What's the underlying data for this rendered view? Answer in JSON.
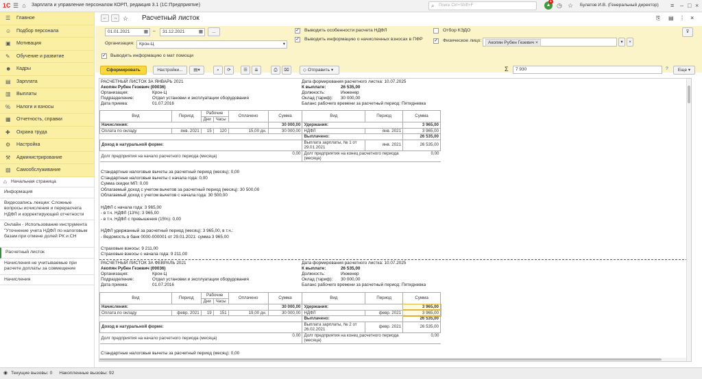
{
  "app": {
    "logo": "1С",
    "title": "Зарплата и управление персоналом КОРП, редакция 3.1  (1С:Предприятие)",
    "search_placeholder": "Поиск Ctrl+Shift+F",
    "notif_count": "1",
    "user": "Булатов И.В. (Генеральный директор)"
  },
  "sidebar": {
    "nav": [
      {
        "icon": "☰",
        "label": "Главное"
      },
      {
        "icon": "☺",
        "label": "Подбор персонала"
      },
      {
        "icon": "▣",
        "label": "Мотивация"
      },
      {
        "icon": "✎",
        "label": "Обучение и развитие"
      },
      {
        "icon": "☻",
        "label": "Кадры"
      },
      {
        "icon": "▤",
        "label": "Зарплата"
      },
      {
        "icon": "▥",
        "label": "Выплаты"
      },
      {
        "icon": "%",
        "label": "Налоги и взносы"
      },
      {
        "icon": "▦",
        "label": "Отчетность, справки"
      },
      {
        "icon": "✚",
        "label": "Охрана труда"
      },
      {
        "icon": "⚙",
        "label": "Настройка"
      },
      {
        "icon": "⚒",
        "label": "Администрирование"
      },
      {
        "icon": "▧",
        "label": "Самообслуживание"
      }
    ],
    "home": "Начальная страница",
    "links": [
      "Информация",
      "Видеозапись лекции: Сложные вопросы исчисления и перерасчета НДФЛ и корректирующей отчетности",
      "Онлайн - Использование инструмента \"Уточнение учета НДФЛ по налоговым базам при отмене долей РК и СН",
      "Расчетный листок",
      "Начисления не учитываемые при расчете доплаты за совмещение",
      "Начисления"
    ]
  },
  "header": {
    "title": "Расчетный листок"
  },
  "filters": {
    "date_from": "01.01.2021",
    "date_to": "31.12.2021",
    "dash": "–",
    "more": "...",
    "org_label": "Организация:",
    "org_value": "Крон-Ц",
    "chk_ndfl": "Выводить особенности расчета НДФЛ",
    "chk_pfr": "Выводить информацию о начисленных взносах в ПФР",
    "chk_kedo": "Отбор КЭДО",
    "chk_person": "Физическое лицо:",
    "person_value": "Акопян Рубен Гезевич",
    "chk_mat": "Выводить информацию о мат помощи"
  },
  "toolbar": {
    "generate": "Сформировать",
    "settings": "Настройки...",
    "send": "Отправить",
    "sigma": "Σ",
    "sum": "7 930",
    "help": "?",
    "more": "Еще"
  },
  "report": {
    "jan": {
      "title": "РАСЧЕТНЫЙ ЛИСТОК ЗА ЯНВАРЬ 2021",
      "name": "Акопян Рубен Гезевич (00036)",
      "org_l": "Организация:",
      "org": "Крон-Ц",
      "dep_l": "Подразделение:",
      "dep": "Отдел установки и эксплуатации оборудования",
      "hire_l": "Дата приема:",
      "hire": "01.07.2016",
      "formed": "Дата формирования расчетного листка: 10.07.2025",
      "topay_l": "К выплате:",
      "topay": "26 535,00",
      "pos_l": "Должность:",
      "pos": "Инженер",
      "rate_l": "Оклад (тариф):",
      "rate": "30 000,00",
      "balance": "Баланс рабочего времени за расчетный период: Пятидневка",
      "h": {
        "vid": "Вид",
        "period": "Период",
        "work": "Рабочие",
        "days": "Дни",
        "hours": "Часы",
        "paid": "Оплачено",
        "sum": "Сумма"
      },
      "accr_l": "Начисления:",
      "accr_sum": "30 000,00",
      "ded_l": "Удержания:",
      "ded_sum": "3 965,00",
      "row": {
        "vid": "Оплата по окладу",
        "period": "янв. 2021",
        "days": "15",
        "hours": "120",
        "paid": "15,00 дн.",
        "sum": "30 000,00"
      },
      "ndfl": "НДФЛ",
      "ndfl_period": "янв. 2021",
      "ndfl_sum": "3 965,00",
      "paid_l": "Выплачено:",
      "paid_sum": "26 535,00",
      "natural": "Доход в натуральной форме:",
      "payout": "Выплата зарплаты, № 1 от 29.01.2021",
      "payout_period": "янв. 2021",
      "payout_sum": "26 535,00",
      "debt_start": "Долг предприятия на начало расчетного периода (месяца)",
      "debt_start_v": "0,00",
      "debt_end": "Долг предприятия на конец расчетного периода (месяца)",
      "debt_end_v": "0,00",
      "notes": [
        "Стандартные налоговые вычеты за расчетный период (месяц): 0,00",
        "Стандартные налоговые вычеты с начала года: 0,00",
        "Сумма скидки МП: 0,00",
        "Облагаемый доход с учетом вычетов за расчетный период (месяц): 30 500,00",
        "Облагаемый доход с учетом вычетов с начала года: 30 500,00",
        "",
        "НДФЛ с начала года: 3 965,00",
        " - в т.ч. НДФЛ (13%): 3 965,00",
        " - в т.ч. НДФЛ с превышения (15%): 0,00",
        "",
        "НДФЛ удержанный за расчетный период (месяц): 3 965,00, в т.ч.:",
        " - Ведомость в банк 0000-000001 от 29.01.2021: сумма 3 965,00",
        "",
        "Страховые взносы: 9 211,00",
        "Страховые взносы с начала года: 9 211,00"
      ]
    },
    "feb": {
      "title": "РАСЧЕТНЫЙ ЛИСТОК ЗА ФЕВРАЛЬ 2021",
      "name": "Акопян Рубен Гезевич (00036)",
      "org_l": "Организация:",
      "org": "Крон-Ц",
      "dep_l": "Подразделение:",
      "dep": "Отдел установки и эксплуатации оборудования",
      "hire_l": "Дата приема:",
      "hire": "01.07.2016",
      "formed": "Дата формирования расчетного листка: 10.07.2025",
      "topay_l": "К выплате:",
      "topay": "26 535,00",
      "pos_l": "Должность:",
      "pos": "Инженер",
      "rate_l": "Оклад (тариф):",
      "rate": "30 000,00",
      "balance": "Баланс рабочего времени за расчетный период: Пятидневка",
      "h": {
        "vid": "Вид",
        "period": "Период",
        "work": "Рабочие",
        "days": "Дни",
        "hours": "Часы",
        "paid": "Оплачено",
        "sum": "Сумма"
      },
      "accr_l": "Начисления:",
      "accr_sum": "30 000,00",
      "ded_l": "Удержания:",
      "ded_sum": "3 965,00",
      "row": {
        "vid": "Оплата по окладу",
        "period": "февр. 2021",
        "days": "19",
        "hours": "151",
        "paid": "19,00 дн.",
        "sum": "30 000,00"
      },
      "ndfl": "НДФЛ",
      "ndfl_period": "февр. 2021",
      "ndfl_sum": "3 965,00",
      "paid_l": "Выплачено:",
      "paid_sum": "26 535,00",
      "natural": "Доход в натуральной форме:",
      "payout": "Выплата зарплаты, № 2 от 26.02.2021",
      "payout_period": "февр. 2021",
      "payout_sum": "26 535,00",
      "debt_start": "Долг предприятия на начало расчетного периода (месяца)",
      "debt_start_v": "0,00",
      "debt_end": "Долг предприятия на конец расчетного периода (месяца)",
      "debt_end_v": "0,00",
      "note1": "Стандартные налоговые вычеты за расчетный период (месяц): 0,00"
    }
  },
  "status": {
    "current": "Текущие вызовы: 0",
    "accum": "Накопленные вызовы: 92"
  }
}
